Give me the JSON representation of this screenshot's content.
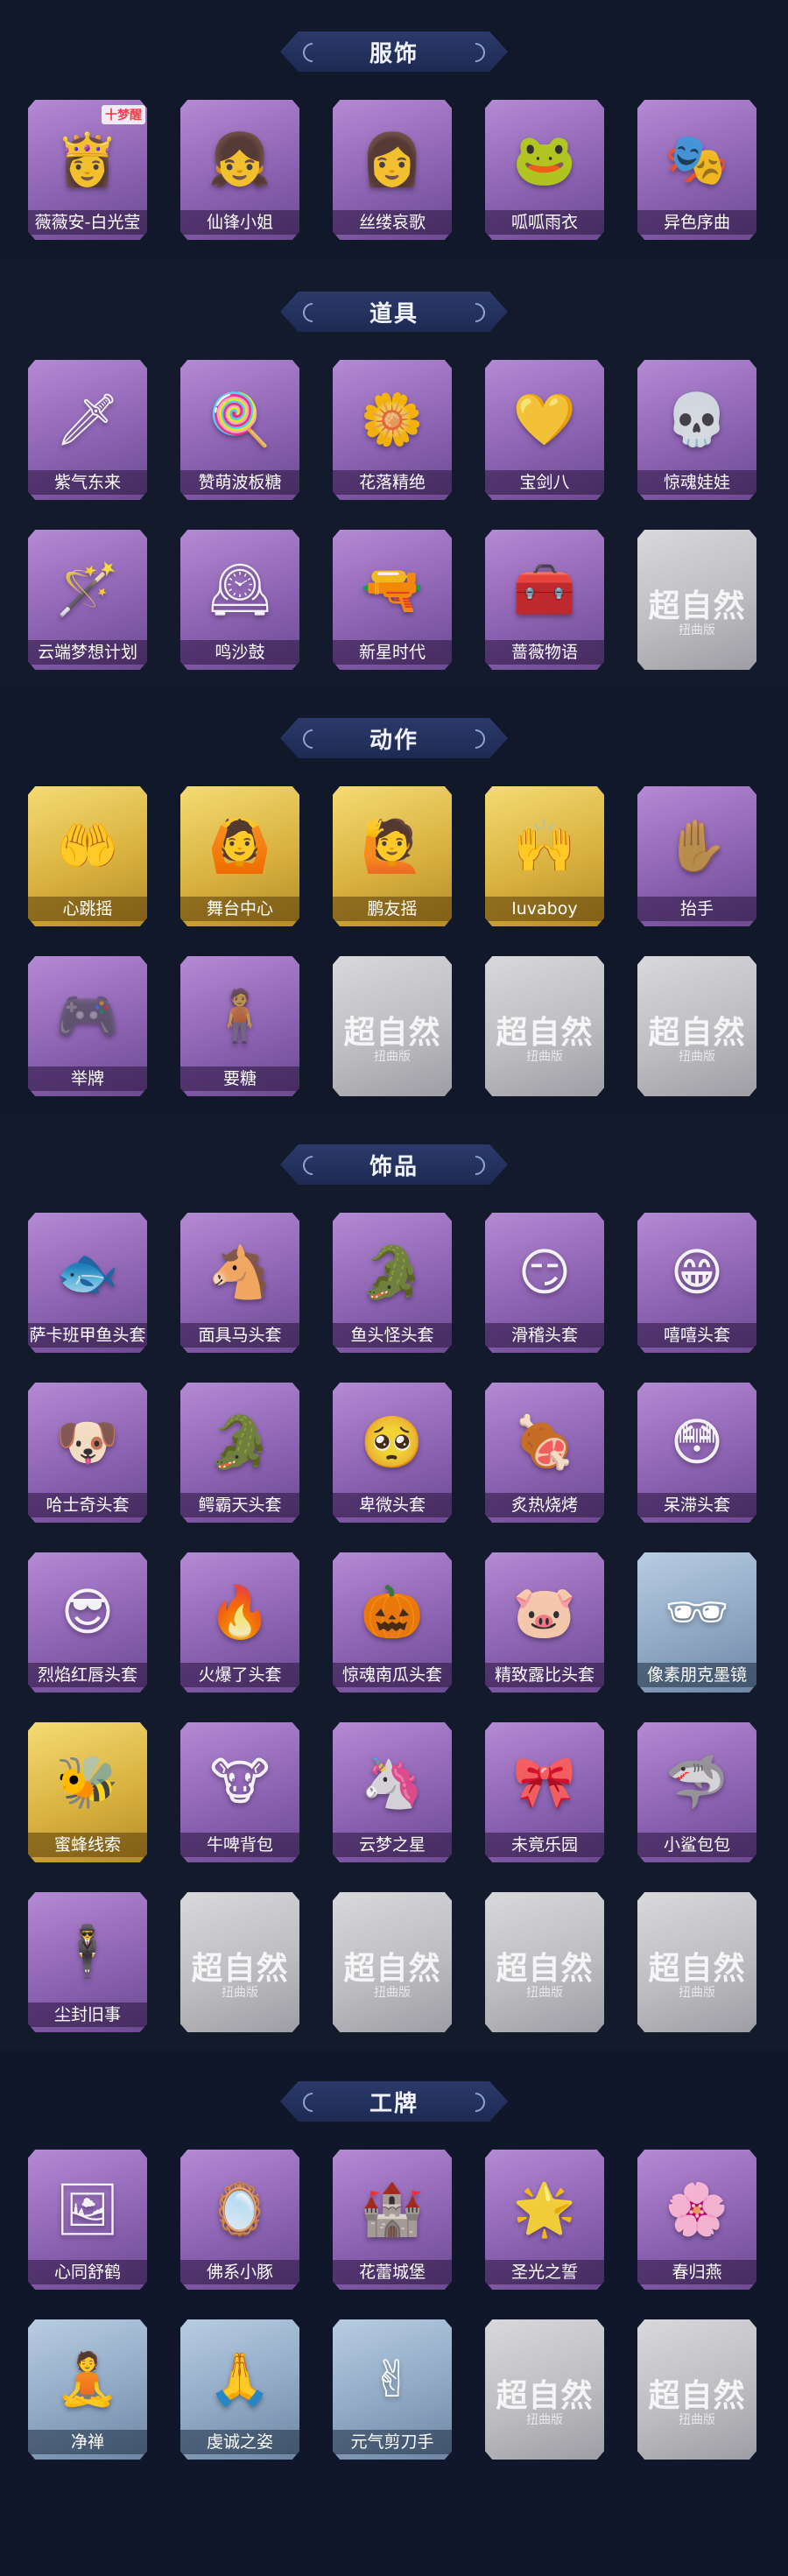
{
  "placeholder": {
    "logo": "超自然",
    "sub": "扭曲版"
  },
  "sections": {
    "clothing": {
      "title": "服饰",
      "items": [
        {
          "name": "薇薇安-白光莹",
          "icon": "portrait-crown-icon",
          "tag": "十梦醒"
        },
        {
          "name": "仙锋小姐",
          "icon": "portrait-girl-icon"
        },
        {
          "name": "丝缕哀歌",
          "icon": "portrait-doll-icon"
        },
        {
          "name": "呱呱雨衣",
          "icon": "portrait-frog-icon"
        },
        {
          "name": "异色序曲",
          "icon": "portrait-masquerade-icon"
        }
      ]
    },
    "props": {
      "title": "道具",
      "items": [
        {
          "name": "紫气东来",
          "icon": "crescent-blade-icon"
        },
        {
          "name": "赞萌波板糖",
          "icon": "lollipop-icon"
        },
        {
          "name": "花落精绝",
          "icon": "flower-chain-icon"
        },
        {
          "name": "宝剑八",
          "icon": "heart-shield-icon"
        },
        {
          "name": "惊魂娃娃",
          "icon": "skull-doll-icon"
        },
        {
          "name": "云端梦想计划",
          "icon": "wand-icon"
        },
        {
          "name": "鸣沙鼓",
          "icon": "ornate-clock-icon"
        },
        {
          "name": "新星时代",
          "icon": "revolver-icon"
        },
        {
          "name": "蔷薇物语",
          "icon": "first-aid-box-icon"
        }
      ]
    },
    "emotes": {
      "title": "动作",
      "items": [
        {
          "name": "心跳摇",
          "icon": "heart-pose-icon"
        },
        {
          "name": "舞台中心",
          "icon": "dance-pose-icon"
        },
        {
          "name": "鹏友摇",
          "icon": "wave-pose-icon"
        },
        {
          "name": "luvaboy",
          "icon": "cheer-pose-icon"
        },
        {
          "name": "抬手",
          "icon": "raise-hand-icon"
        },
        {
          "name": "举牌",
          "icon": "sign-holder-icon"
        },
        {
          "name": "要糖",
          "icon": "candy-ask-icon"
        }
      ]
    },
    "accessories": {
      "title": "饰品",
      "items": [
        {
          "name": "萨卡班甲鱼头套",
          "icon": "fish-head-icon"
        },
        {
          "name": "面具马头套",
          "icon": "horse-head-icon"
        },
        {
          "name": "鱼头怪头套",
          "icon": "fish-monster-icon"
        },
        {
          "name": "滑稽头套",
          "icon": "smirk-face-icon"
        },
        {
          "name": "嘻嘻头套",
          "icon": "grin-face-icon"
        },
        {
          "name": "哈士奇头套",
          "icon": "husky-head-icon"
        },
        {
          "name": "鳄霸天头套",
          "icon": "crocodile-head-icon"
        },
        {
          "name": "卑微头套",
          "icon": "meek-face-icon"
        },
        {
          "name": "炙热烧烤",
          "icon": "bbq-meat-icon"
        },
        {
          "name": "呆滞头套",
          "icon": "dazed-face-icon"
        },
        {
          "name": "烈焰红唇头套",
          "icon": "pikachu-head-icon"
        },
        {
          "name": "火爆了头套",
          "icon": "fire-face-icon"
        },
        {
          "name": "惊魂南瓜头套",
          "icon": "pumpkin-head-icon"
        },
        {
          "name": "精致露比头套",
          "icon": "pink-beaver-icon"
        },
        {
          "name": "像素朋克墨镜",
          "icon": "pixel-sunglasses-icon"
        },
        {
          "name": "蜜蜂线索",
          "icon": "bee-beaver-icon"
        },
        {
          "name": "牛啤背包",
          "icon": "cow-barrel-icon"
        },
        {
          "name": "云梦之星",
          "icon": "unicorn-cloud-icon"
        },
        {
          "name": "未竟乐园",
          "icon": "pink-idol-icon"
        },
        {
          "name": "小鲨包包",
          "icon": "shark-plush-icon"
        },
        {
          "name": "尘封旧事",
          "icon": "chibi-figure-icon"
        }
      ]
    },
    "badges": {
      "title": "工牌",
      "items": [
        {
          "name": "心同舒鹤",
          "icon": "gold-card-icon"
        },
        {
          "name": "佛系小豚",
          "icon": "mirror-frame-icon"
        },
        {
          "name": "花蕾城堡",
          "icon": "castle-card-icon"
        },
        {
          "name": "圣光之誓",
          "icon": "sun-card-icon"
        },
        {
          "name": "春归燕",
          "icon": "pink-card-icon"
        },
        {
          "name": "净禅",
          "icon": "silhouette-card-icon"
        },
        {
          "name": "虔诚之姿",
          "icon": "silhouette-pose-icon"
        },
        {
          "name": "元气剪刀手",
          "icon": "silhouette-peace-icon"
        }
      ]
    }
  }
}
